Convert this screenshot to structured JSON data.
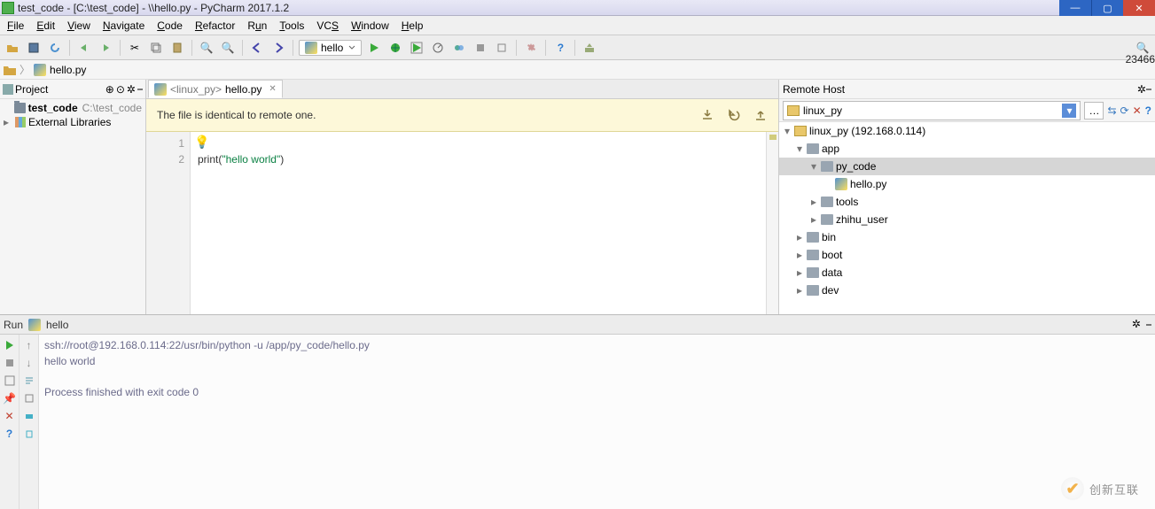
{
  "window": {
    "title": "test_code - [C:\\test_code] - \\\\hello.py - PyCharm 2017.1.2"
  },
  "edge_number": "23466",
  "menu": {
    "file": "File",
    "edit": "Edit",
    "view": "View",
    "navigate": "Navigate",
    "code": "Code",
    "refactor": "Refactor",
    "run": "Run",
    "tools": "Tools",
    "vcs": "VCS",
    "window": "Window",
    "help": "Help"
  },
  "run_config": {
    "name": "hello"
  },
  "breadcrumb": {
    "file": "hello.py"
  },
  "project": {
    "panel_title": "Project",
    "root_name": "test_code",
    "root_path": "C:\\test_code",
    "ext_libs": "External Libraries"
  },
  "editor": {
    "tab_prefix": "<linux_py>",
    "tab_file": "hello.py",
    "notice": "The file is identical to remote one.",
    "lines": {
      "l1": "1",
      "l2": "2"
    },
    "code": {
      "fn": "print",
      "open": "(",
      "str": "\"hello world\"",
      "close": ")"
    }
  },
  "remote": {
    "panel_title": "Remote Host",
    "selected": "linux_py",
    "root": "linux_py (192.168.0.114)",
    "app": "app",
    "py_code": "py_code",
    "hello": "hello.py",
    "tools": "tools",
    "zhihu": "zhihu_user",
    "bin": "bin",
    "boot": "boot",
    "data": "data",
    "dev": "dev"
  },
  "run": {
    "label": "Run",
    "name": "hello",
    "cmd": "ssh://root@192.168.0.114:22/usr/bin/python -u /app/py_code/hello.py",
    "out": "hello world",
    "exit": "Process finished with exit code 0"
  },
  "watermark": "创新互联"
}
